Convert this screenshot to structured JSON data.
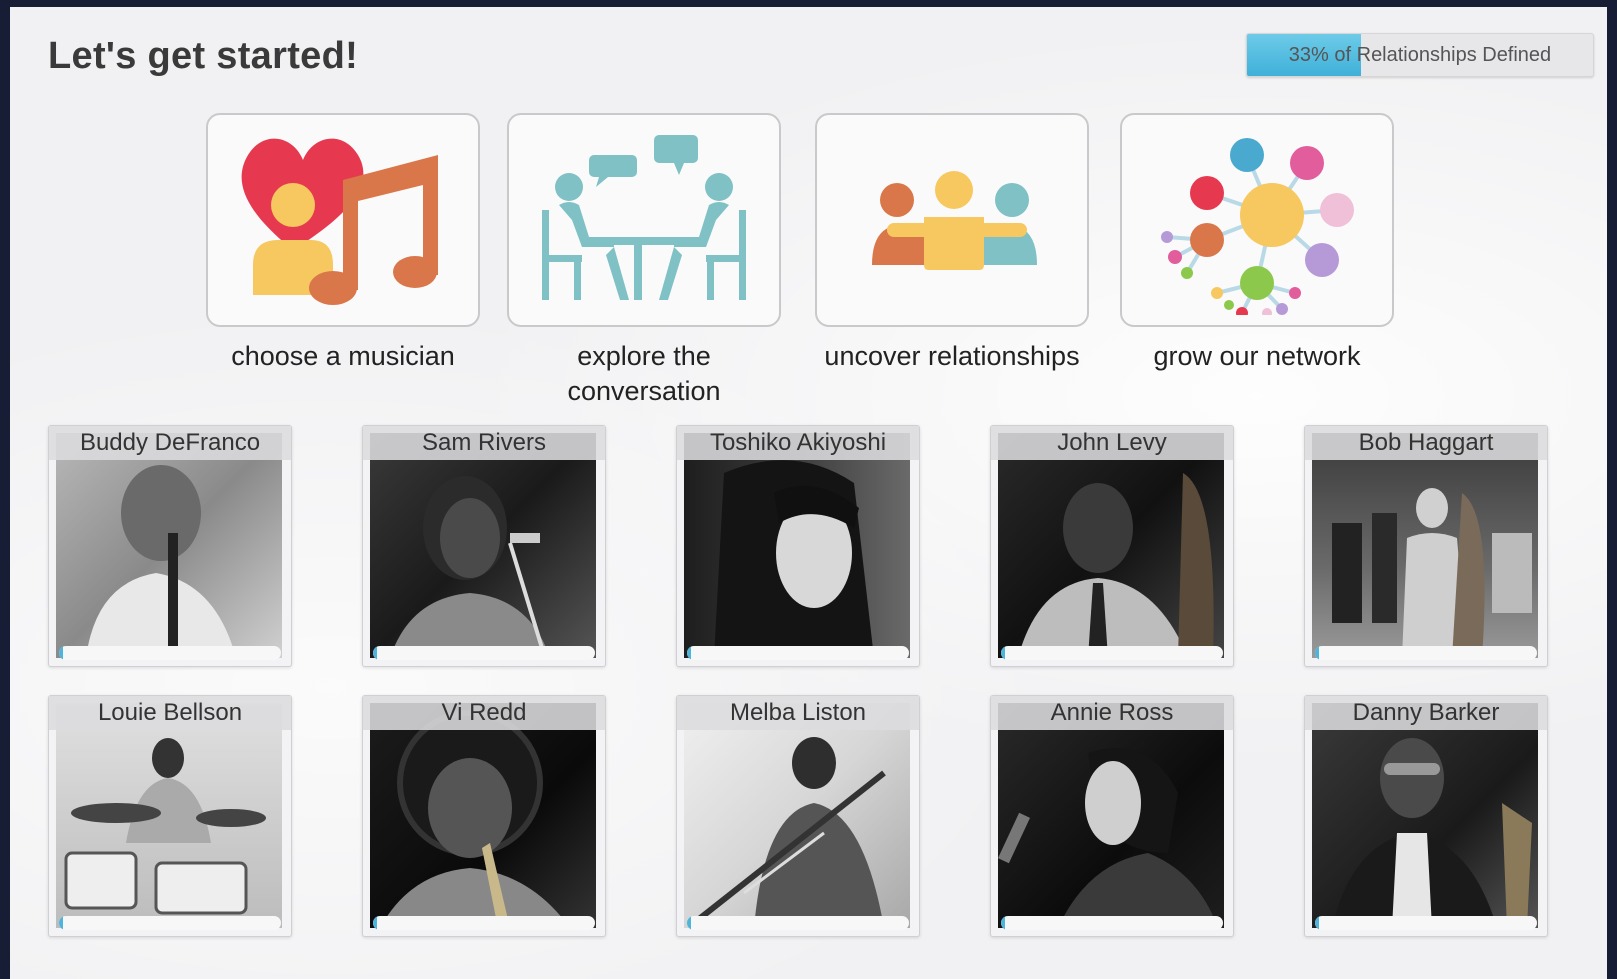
{
  "page": {
    "title": "Let's get started!",
    "progress_label": "33% of Relationships Defined",
    "progress_value": 0.33
  },
  "colors": {
    "accent": "#3fb0d9",
    "red": "#e63950",
    "yellow": "#f6c85f",
    "orange": "#d9774a",
    "teal": "#7fc1c4",
    "pink": "#e25d9c",
    "lavender": "#b69ad8",
    "green": "#8cc84b",
    "blue": "#4aa9cf"
  },
  "steps": [
    {
      "label": "choose a musician",
      "icon": "heart-music-note-icon"
    },
    {
      "label": "explore the\nconversation",
      "icon": "people-conversation-table-icon"
    },
    {
      "label": "uncover relationships",
      "icon": "three-people-embrace-icon"
    },
    {
      "label": "grow our network",
      "icon": "network-graph-icon"
    }
  ],
  "musicians": [
    {
      "name": "Buddy DeFranco",
      "progress": 0.02
    },
    {
      "name": "Sam Rivers",
      "progress": 0.02
    },
    {
      "name": "Toshiko Akiyoshi",
      "progress": 0.02
    },
    {
      "name": "John Levy",
      "progress": 0.02
    },
    {
      "name": "Bob Haggart",
      "progress": 0.02
    },
    {
      "name": "Louie Bellson",
      "progress": 0.02
    },
    {
      "name": "Vi Redd",
      "progress": 0.02
    },
    {
      "name": "Melba Liston",
      "progress": 0.02
    },
    {
      "name": "Annie Ross",
      "progress": 0.02
    },
    {
      "name": "Danny Barker",
      "progress": 0.02
    }
  ]
}
